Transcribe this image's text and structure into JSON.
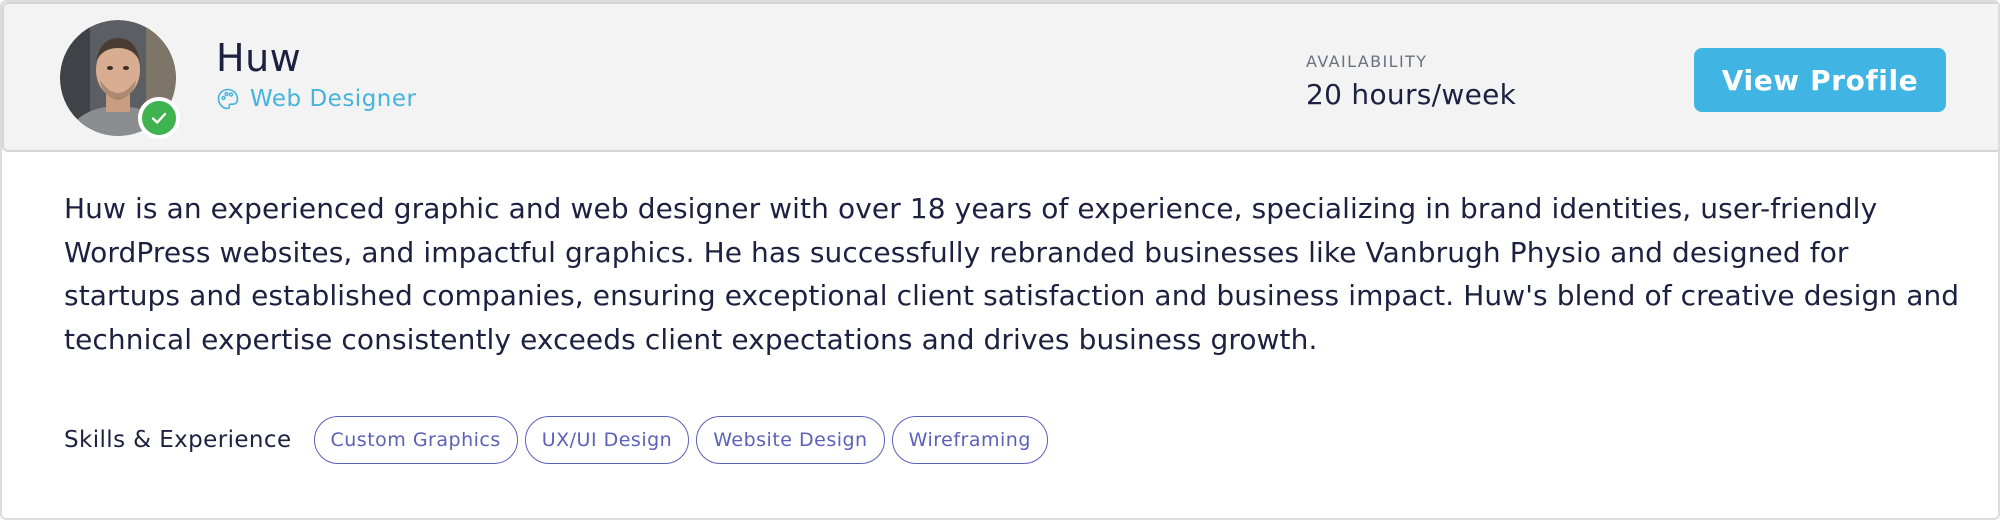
{
  "profile": {
    "name": "Huw",
    "role": "Web Designer",
    "role_icon": "palette-icon",
    "verified_icon": "checkmark-icon",
    "availability_label": "AVAILABILITY",
    "availability_value": "20 hours/week",
    "view_button_label": "View Profile",
    "bio": "Huw is an experienced graphic and web designer with over 18 years of experience, specializing in brand identities, user-friendly WordPress websites, and impactful graphics. He has successfully rebranded businesses like Vanbrugh Physio and designed for startups and established companies, ensuring exceptional client satisfaction and business impact. Huw's blend of creative design and technical expertise consistently exceeds client expectations and drives business growth."
  },
  "skills": {
    "label": "Skills & Experience",
    "tags": [
      "Custom Graphics",
      "UX/UI Design",
      "Website Design",
      "Wireframing"
    ]
  },
  "colors": {
    "accent": "#40b4e3",
    "role_text": "#44b3dd",
    "verified": "#3fb34f",
    "tag": "#5a61b8",
    "header_bg": "#f3f3f3"
  }
}
